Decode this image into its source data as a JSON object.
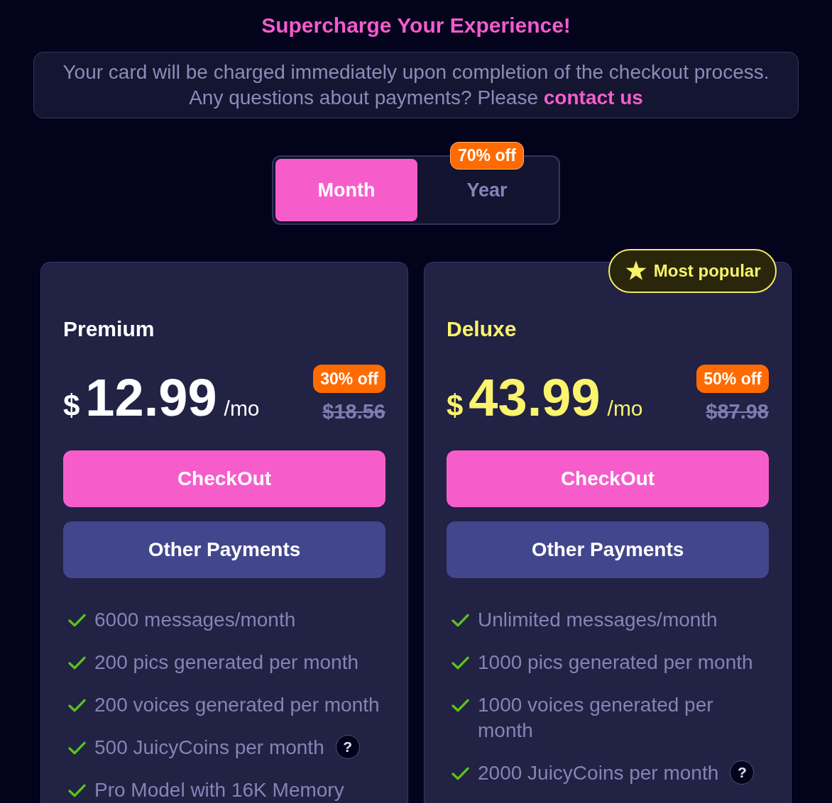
{
  "header": {
    "title": "Supercharge Your Experience!"
  },
  "notice": {
    "lines": [
      "Your card will be charged immediately upon completion of the checkout process.",
      "Any questions about payments? Please"
    ],
    "link": "contact us"
  },
  "billing_toggle": {
    "options": [
      {
        "label": "Month",
        "selected": true
      },
      {
        "label": "Year",
        "selected": false,
        "badge": "70% off"
      }
    ]
  },
  "plans": [
    {
      "name": "Premium",
      "featured": false,
      "currency": "$",
      "price": "12.99",
      "period": "/mo",
      "discount": "30% off",
      "original_price": "$18.56",
      "checkout_button": "CheckOut",
      "other_button": "Other Payments",
      "features": [
        {
          "text": "6000 messages/month"
        },
        {
          "text": "200 pics generated per month"
        },
        {
          "text": "200 voices generated per month"
        },
        {
          "text": "500 JuicyCoins per month",
          "help": "?"
        },
        {
          "text": "Pro Model with 16K Memory"
        }
      ]
    },
    {
      "name": "Deluxe",
      "featured": true,
      "ribbon": "Most popular",
      "currency": "$",
      "price": "43.99",
      "period": "/mo",
      "discount": "50% off",
      "original_price": "$87.98",
      "checkout_button": "CheckOut",
      "other_button": "Other Payments",
      "features": [
        {
          "text": "Unlimited messages/month"
        },
        {
          "text": "1000 pics generated per month"
        },
        {
          "text": "1000 voices generated per month"
        },
        {
          "text": "2000 JuicyCoins per month",
          "help": "?"
        }
      ]
    }
  ]
}
